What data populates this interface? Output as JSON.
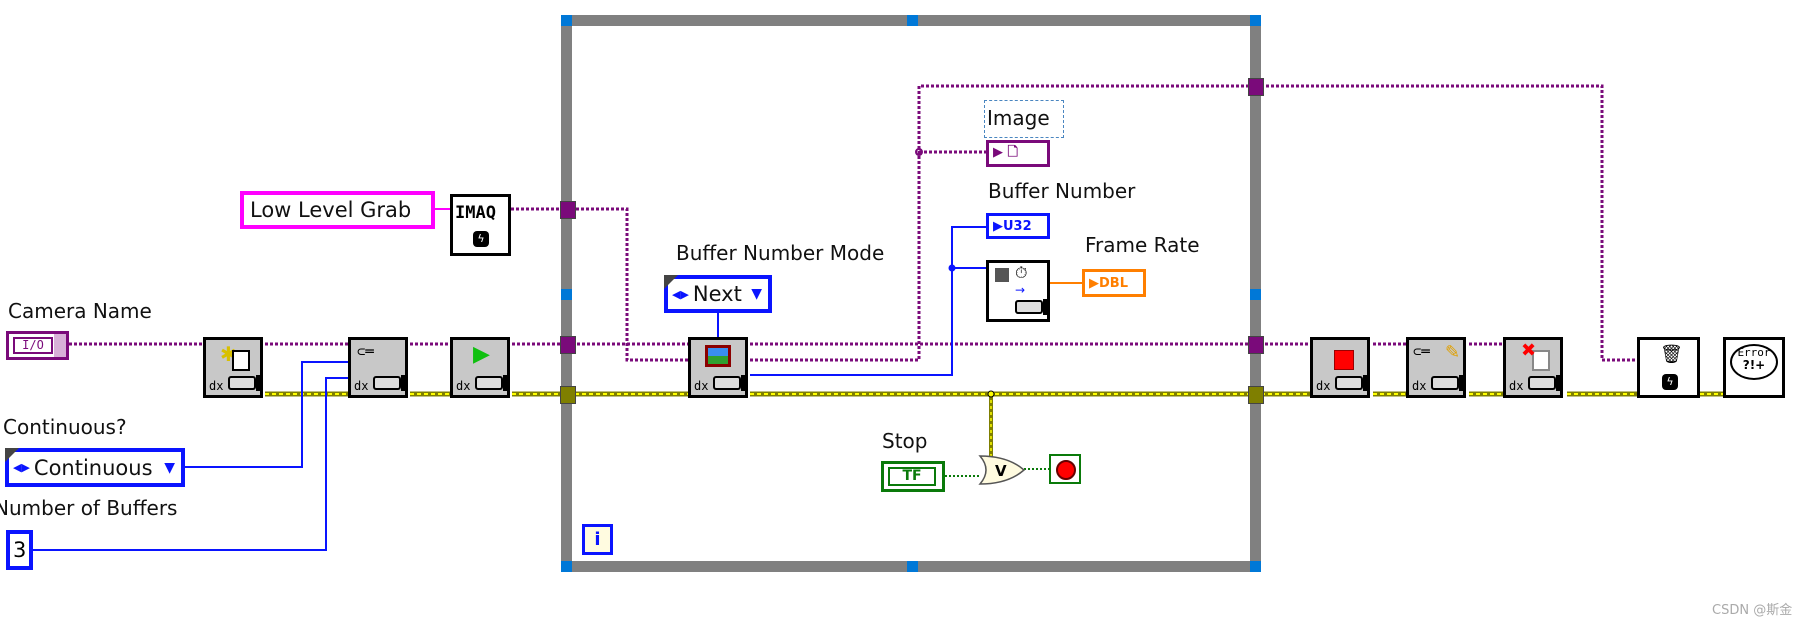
{
  "controls": {
    "camera_name": {
      "label": "Camera Name",
      "value": "I/O"
    },
    "continuous": {
      "label": "Continuous?",
      "value": "Continuous"
    },
    "number_of_buffers": {
      "label": "Number of Buffers",
      "value": "3"
    },
    "grab_mode": {
      "value": "Low Level Grab"
    },
    "buffer_number_mode": {
      "label": "Buffer Number Mode",
      "value": "Next"
    },
    "stop": {
      "label": "Stop",
      "value": "TF"
    }
  },
  "indicators": {
    "image": {
      "label": "Image"
    },
    "buffer_number": {
      "label": "Buffer Number",
      "type": "U32"
    },
    "frame_rate": {
      "label": "Frame Rate",
      "type": "DBL"
    }
  },
  "nodes": {
    "imaq_constant": "IMAQ",
    "error_handler": "Error",
    "error_symbols": "?!+"
  },
  "loop": {
    "iteration_terminal": "i"
  },
  "watermark": "CSDN @斯金",
  "colors": {
    "session_wire": "#7a0a7a",
    "error_wire": "#7f7f00",
    "numeric_wire": "#0a14ff",
    "double_wire": "#ff7f00",
    "boolean_wire": "#0a7a0a",
    "loop_border": "#808080",
    "string_constant": "#ff00ff"
  }
}
